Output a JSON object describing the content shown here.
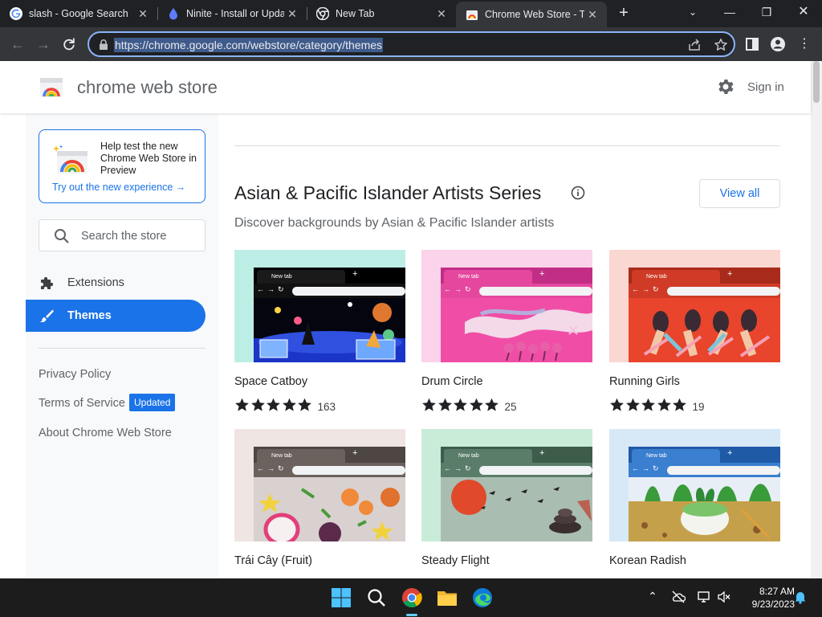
{
  "browser": {
    "tabs": [
      {
        "title": "slash - Google Search",
        "favicon": "google-g-icon",
        "active": false
      },
      {
        "title": "Ninite - Install or Update",
        "favicon": "ninite-drop-icon",
        "active": false
      },
      {
        "title": "New Tab",
        "favicon": "chrome-icon",
        "active": false
      },
      {
        "title": "Chrome Web Store - Th",
        "favicon": "chrome-web-store-icon",
        "active": true
      }
    ],
    "address": "https://chrome.google.com/webstore/category/themes"
  },
  "store": {
    "title": "chrome web store",
    "sign_in": "Sign in",
    "preview_card": {
      "text": "Help test the new Chrome Web Store in Preview",
      "link": "Try out the new experience →"
    },
    "search": {
      "placeholder": "Search the store"
    },
    "nav": [
      {
        "label": "Extensions",
        "icon": "puzzle-icon",
        "active": false
      },
      {
        "label": "Themes",
        "icon": "brush-icon",
        "active": true
      }
    ],
    "footer_links": {
      "privacy": "Privacy Policy",
      "terms": "Terms of Service",
      "updated_badge": "Updated",
      "about": "About Chrome Web Store"
    },
    "section": {
      "title": "Asian & Pacific Islander Artists Series",
      "subtitle": "Discover backgrounds by Asian & Pacific Islander artists",
      "view_all": "View all"
    },
    "mini_tab_label": "New tab",
    "themes": [
      {
        "name": "Space Catboy",
        "rating_stars": 5,
        "rating_count": "163"
      },
      {
        "name": "Drum Circle",
        "rating_stars": 5,
        "rating_count": "25"
      },
      {
        "name": "Running Girls",
        "rating_stars": 5,
        "rating_count": "19"
      },
      {
        "name": "Trái Cây (Fruit)",
        "rating_stars": 5,
        "rating_count": ""
      },
      {
        "name": "Steady Flight",
        "rating_stars": 5,
        "rating_count": ""
      },
      {
        "name": "Korean Radish",
        "rating_stars": 5,
        "rating_count": ""
      }
    ]
  },
  "taskbar": {
    "time": "8:27 AM",
    "date": "9/23/2023"
  }
}
